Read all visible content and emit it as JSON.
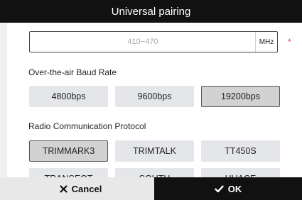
{
  "dialog": {
    "title": "Universal pairing"
  },
  "frequency": {
    "placeholder": "410−470",
    "unit": "MHz",
    "required_mark": "*"
  },
  "baud": {
    "label": "Over-the-air Baud Rate",
    "options": [
      {
        "label": "4800bps",
        "selected": false
      },
      {
        "label": "9600bps",
        "selected": false
      },
      {
        "label": "19200bps",
        "selected": true
      }
    ]
  },
  "protocol": {
    "label": "Radio Communication Protocol",
    "options": [
      {
        "label": "TRIMMARK3",
        "selected": true
      },
      {
        "label": "TRIMTALK",
        "selected": false
      },
      {
        "label": "TT450S",
        "selected": false
      },
      {
        "label": "TRANSEOT",
        "selected": false
      },
      {
        "label": "SOUTH",
        "selected": false
      },
      {
        "label": "HUACE",
        "selected": false
      }
    ]
  },
  "footer": {
    "cancel_label": "Cancel",
    "cancel_icon": "close-icon",
    "ok_label": "OK",
    "ok_icon": "check-icon"
  },
  "colors": {
    "title_bg": "#111111",
    "option_bg": "#e5e6e9",
    "option_selected_bg": "#d2d2d2",
    "required": "#e23b3b"
  }
}
